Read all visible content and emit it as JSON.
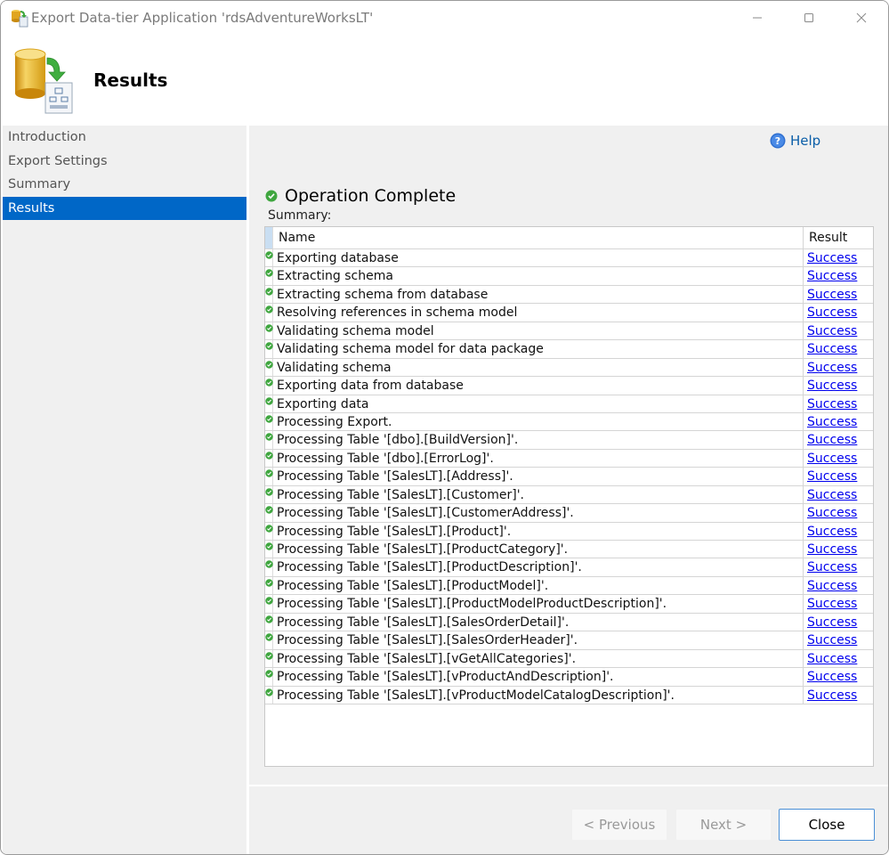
{
  "window": {
    "title": "Export Data-tier Application 'rdsAdventureWorksLT'",
    "icons": {
      "app": "export-data-tier-icon",
      "minimize": "minimize-icon",
      "maximize": "maximize-icon",
      "close": "close-icon"
    }
  },
  "header": {
    "title": "Results",
    "icon": "database-export-icon"
  },
  "sidebar": {
    "items": [
      {
        "label": "Introduction",
        "active": false
      },
      {
        "label": "Export Settings",
        "active": false
      },
      {
        "label": "Summary",
        "active": false
      },
      {
        "label": "Results",
        "active": true
      }
    ]
  },
  "content": {
    "help_label": "Help",
    "status_title": "Operation Complete",
    "summary_label": "Summary:",
    "columns": {
      "name": "Name",
      "result": "Result"
    },
    "rows": [
      {
        "name": "Exporting database",
        "result": "Success"
      },
      {
        "name": "Extracting schema",
        "result": "Success"
      },
      {
        "name": "Extracting schema from database",
        "result": "Success"
      },
      {
        "name": "Resolving references in schema model",
        "result": "Success"
      },
      {
        "name": "Validating schema model",
        "result": "Success"
      },
      {
        "name": "Validating schema model for data package",
        "result": "Success"
      },
      {
        "name": "Validating schema",
        "result": "Success"
      },
      {
        "name": "Exporting data from database",
        "result": "Success"
      },
      {
        "name": "Exporting data",
        "result": "Success"
      },
      {
        "name": "Processing Export.",
        "result": "Success"
      },
      {
        "name": "Processing Table '[dbo].[BuildVersion]'.",
        "result": "Success"
      },
      {
        "name": "Processing Table '[dbo].[ErrorLog]'.",
        "result": "Success"
      },
      {
        "name": "Processing Table '[SalesLT].[Address]'.",
        "result": "Success"
      },
      {
        "name": "Processing Table '[SalesLT].[Customer]'.",
        "result": "Success"
      },
      {
        "name": "Processing Table '[SalesLT].[CustomerAddress]'.",
        "result": "Success"
      },
      {
        "name": "Processing Table '[SalesLT].[Product]'.",
        "result": "Success"
      },
      {
        "name": "Processing Table '[SalesLT].[ProductCategory]'.",
        "result": "Success"
      },
      {
        "name": "Processing Table '[SalesLT].[ProductDescription]'.",
        "result": "Success"
      },
      {
        "name": "Processing Table '[SalesLT].[ProductModel]'.",
        "result": "Success"
      },
      {
        "name": "Processing Table '[SalesLT].[ProductModelProductDescription]'.",
        "result": "Success"
      },
      {
        "name": "Processing Table '[SalesLT].[SalesOrderDetail]'.",
        "result": "Success"
      },
      {
        "name": "Processing Table '[SalesLT].[SalesOrderHeader]'.",
        "result": "Success"
      },
      {
        "name": "Processing Table '[SalesLT].[vGetAllCategories]'.",
        "result": "Success"
      },
      {
        "name": "Processing Table '[SalesLT].[vProductAndDescription]'.",
        "result": "Success"
      },
      {
        "name": "Processing Table '[SalesLT].[vProductModelCatalogDescription]'.",
        "result": "Success"
      }
    ]
  },
  "footer": {
    "previous_label": "< Previous",
    "next_label": "Next >",
    "close_label": "Close"
  },
  "colors": {
    "accent": "#0067c7",
    "link": "#0000ee",
    "success": "#3fa63f"
  }
}
